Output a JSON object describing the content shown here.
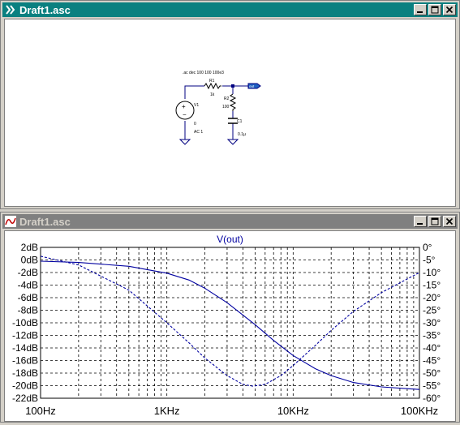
{
  "schematic_window": {
    "title": "Draft1.asc",
    "directive": ".ac dec 100 100 100e3",
    "components": {
      "r1_name": "R1",
      "r1_value": "1k",
      "r2_name": "R2",
      "r2_value": "100",
      "c1_name": "C1",
      "c1_value": "0.1µ",
      "v1_name": "V1",
      "v1_value": "0",
      "v1_ac": "AC 1",
      "net_label": "out"
    }
  },
  "plot_window": {
    "title": "Draft1.asc",
    "trace_name": "V(out)",
    "colors": {
      "trace": "#0000a0",
      "grid": "#000000",
      "title_active": "#0a8080",
      "title_inactive": "#808080"
    }
  },
  "chart_data": {
    "type": "line",
    "title": "V(out)",
    "xscale": "log",
    "xlim": [
      100,
      100000
    ],
    "x_ticks": [
      "100Hz",
      "1KHz",
      "10KHz",
      "100KHz"
    ],
    "y_left_ticks": [
      "2dB",
      "0dB",
      "-2dB",
      "-4dB",
      "-6dB",
      "-8dB",
      "-10dB",
      "-12dB",
      "-14dB",
      "-16dB",
      "-18dB",
      "-20dB",
      "-22dB"
    ],
    "y_right_ticks": [
      "0°",
      "-5°",
      "-10°",
      "-15°",
      "-20°",
      "-25°",
      "-30°",
      "-35°",
      "-40°",
      "-45°",
      "-50°",
      "-55°",
      "-60°"
    ],
    "ylim_left": [
      -22,
      2
    ],
    "ylim_right": [
      -60,
      0
    ],
    "grid": true,
    "series": [
      {
        "name": "V(out)",
        "style": "solid",
        "axis": "left",
        "x": [
          100,
          200,
          500,
          1000,
          1500,
          2000,
          3000,
          5000,
          7000,
          10000,
          15000,
          20000,
          30000,
          50000,
          100000
        ],
        "y": [
          -0.2,
          -0.4,
          -1.0,
          -2.1,
          -3.2,
          -4.5,
          -6.8,
          -10.3,
          -12.8,
          -15.2,
          -17.3,
          -18.4,
          -19.5,
          -20.2,
          -20.6
        ]
      },
      {
        "name": "V(out)",
        "style": "dashed",
        "axis": "right",
        "x": [
          100,
          200,
          500,
          1000,
          1500,
          2000,
          3000,
          4000,
          4800,
          6000,
          8000,
          10000,
          15000,
          20000,
          30000,
          50000,
          100000
        ],
        "y": [
          -3.5,
          -7,
          -17,
          -30,
          -38,
          -44,
          -51,
          -54.5,
          -55.2,
          -54.5,
          -51,
          -47,
          -39,
          -33,
          -25.5,
          -18,
          -10
        ]
      }
    ]
  }
}
